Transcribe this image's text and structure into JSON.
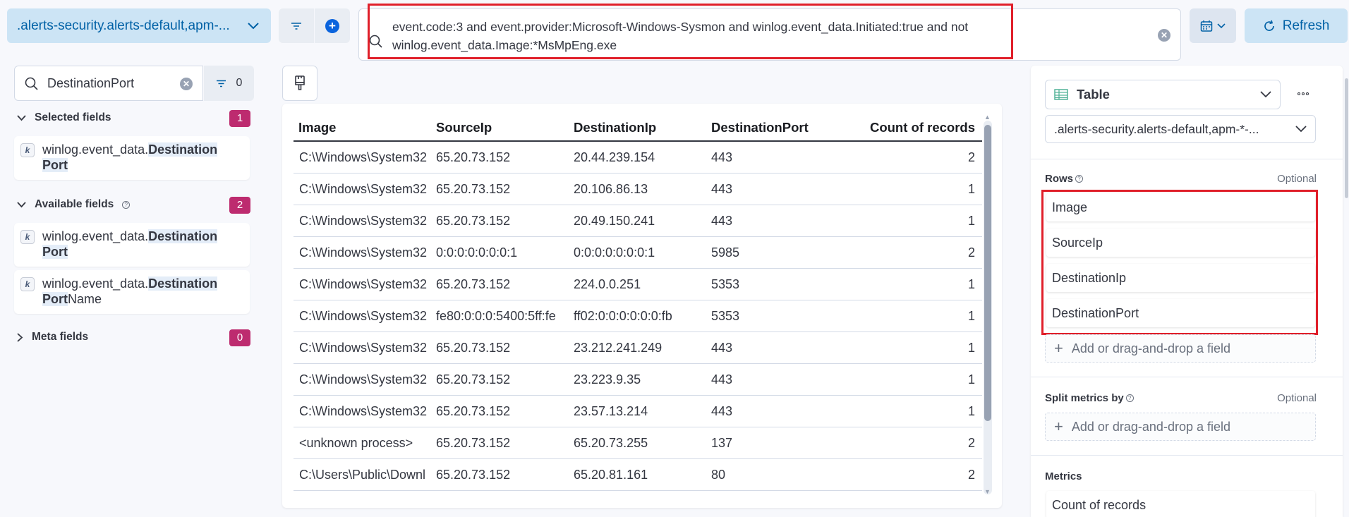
{
  "topbar": {
    "dataview_label": ".alerts-security.alerts-default,apm-...",
    "query_text": "event.code:3 and event.provider:Microsoft-Windows-Sysmon and winlog.event_data.Initiated:true and not winlog.event_data.Image:*MsMpEng.exe",
    "refresh_label": "Refresh"
  },
  "sidebar": {
    "search_value": "DestinationPort",
    "filter_count": "0",
    "selected": {
      "label": "Selected fields",
      "count": "1",
      "fields": [
        {
          "type": "k",
          "prefix": "winlog.event_data.",
          "match": "DestinationPort",
          "suffix": ""
        }
      ]
    },
    "available": {
      "label": "Available fields",
      "count": "2",
      "fields": [
        {
          "type": "k",
          "prefix": "winlog.event_data.",
          "match": "DestinationPort",
          "suffix": ""
        },
        {
          "type": "k",
          "prefix": "winlog.event_data.",
          "match": "DestinationPort",
          "suffix": "Name"
        }
      ]
    },
    "meta": {
      "label": "Meta fields",
      "count": "0"
    }
  },
  "table": {
    "columns": [
      "Image",
      "SourceIp",
      "DestinationIp",
      "DestinationPort",
      "Count of records"
    ],
    "rows": [
      [
        "C:\\Windows\\System32",
        "65.20.73.152",
        "20.44.239.154",
        "443",
        "2"
      ],
      [
        "C:\\Windows\\System32",
        "65.20.73.152",
        "20.106.86.13",
        "443",
        "1"
      ],
      [
        "C:\\Windows\\System32",
        "65.20.73.152",
        "20.49.150.241",
        "443",
        "1"
      ],
      [
        "C:\\Windows\\System32",
        "0:0:0:0:0:0:0:1",
        "0:0:0:0:0:0:0:1",
        "5985",
        "2"
      ],
      [
        "C:\\Windows\\System32",
        "65.20.73.152",
        "224.0.0.251",
        "5353",
        "1"
      ],
      [
        "C:\\Windows\\System32",
        "fe80:0:0:0:5400:5ff:fe",
        "ff02:0:0:0:0:0:0:fb",
        "5353",
        "1"
      ],
      [
        "C:\\Windows\\System32",
        "65.20.73.152",
        "23.212.241.249",
        "443",
        "1"
      ],
      [
        "C:\\Windows\\System32",
        "65.20.73.152",
        "23.223.9.35",
        "443",
        "1"
      ],
      [
        "C:\\Windows\\System32",
        "65.20.73.152",
        "23.57.13.214",
        "443",
        "1"
      ],
      [
        "<unknown process>",
        "65.20.73.152",
        "65.20.73.255",
        "137",
        "2"
      ],
      [
        "C:\\Users\\Public\\Downl",
        "65.20.73.152",
        "65.20.81.161",
        "80",
        "2"
      ]
    ]
  },
  "config": {
    "vis_type": "Table",
    "layer_source": ".alerts-security.alerts-default,apm-*-...",
    "rows_label": "Rows",
    "optional_label": "Optional",
    "row_fields": [
      "Image",
      "SourceIp",
      "DestinationIp",
      "DestinationPort"
    ],
    "add_field_label": "Add or drag-and-drop a field",
    "split_label": "Split metrics by",
    "metrics_label": "Metrics",
    "metric_fields": [
      "Count of records"
    ]
  },
  "colors": {
    "accent": "#0b64dd",
    "badge": "#bd2b6f",
    "highlight": "#e01f2a"
  }
}
